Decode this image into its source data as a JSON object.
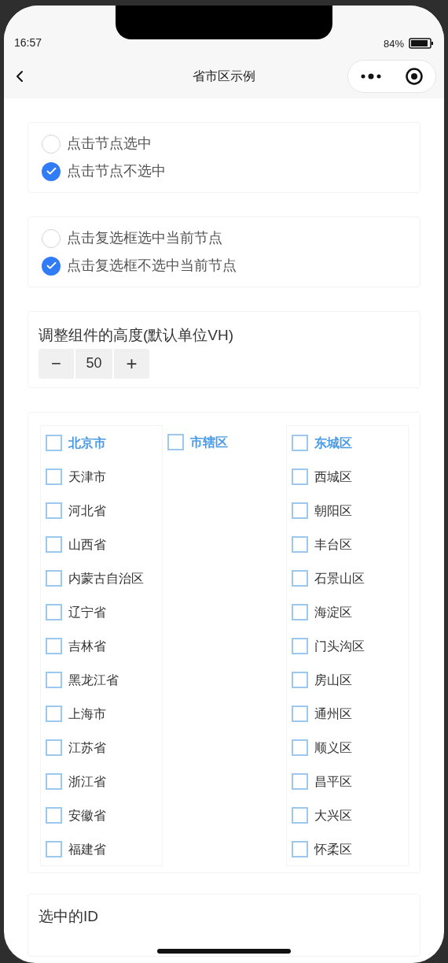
{
  "status_bar": {
    "time": "16:57",
    "battery": "84%"
  },
  "nav": {
    "title": "省市区示例"
  },
  "radio_groups": [
    {
      "options": [
        {
          "label": "点击节点选中",
          "selected": false
        },
        {
          "label": "点击节点不选中",
          "selected": true
        }
      ]
    },
    {
      "options": [
        {
          "label": "点击复选框选中当前节点",
          "selected": false
        },
        {
          "label": "点击复选框不选中当前节点",
          "selected": true
        }
      ]
    }
  ],
  "height_setting": {
    "label": "调整组件的高度(默认单位VH)",
    "minus": "−",
    "value": "50",
    "plus": "+"
  },
  "picker": {
    "columns": [
      {
        "items": [
          {
            "label": "北京市",
            "active": true,
            "checked": false
          },
          {
            "label": "天津市",
            "active": false,
            "checked": false
          },
          {
            "label": "河北省",
            "active": false,
            "checked": false
          },
          {
            "label": "山西省",
            "active": false,
            "checked": false
          },
          {
            "label": "内蒙古自治区",
            "active": false,
            "checked": false
          },
          {
            "label": "辽宁省",
            "active": false,
            "checked": false
          },
          {
            "label": "吉林省",
            "active": false,
            "checked": false
          },
          {
            "label": "黑龙江省",
            "active": false,
            "checked": false
          },
          {
            "label": "上海市",
            "active": false,
            "checked": false
          },
          {
            "label": "江苏省",
            "active": false,
            "checked": false
          },
          {
            "label": "浙江省",
            "active": false,
            "checked": false
          },
          {
            "label": "安徽省",
            "active": false,
            "checked": false
          },
          {
            "label": "福建省",
            "active": false,
            "checked": false
          }
        ]
      },
      {
        "items": [
          {
            "label": "市辖区",
            "active": true,
            "checked": false
          }
        ]
      },
      {
        "items": [
          {
            "label": "东城区",
            "active": true,
            "checked": false
          },
          {
            "label": "西城区",
            "active": false,
            "checked": false
          },
          {
            "label": "朝阳区",
            "active": false,
            "checked": false
          },
          {
            "label": "丰台区",
            "active": false,
            "checked": false
          },
          {
            "label": "石景山区",
            "active": false,
            "checked": false
          },
          {
            "label": "海淀区",
            "active": false,
            "checked": false
          },
          {
            "label": "门头沟区",
            "active": false,
            "checked": false
          },
          {
            "label": "房山区",
            "active": false,
            "checked": false
          },
          {
            "label": "通州区",
            "active": false,
            "checked": false
          },
          {
            "label": "顺义区",
            "active": false,
            "checked": false
          },
          {
            "label": "昌平区",
            "active": false,
            "checked": false
          },
          {
            "label": "大兴区",
            "active": false,
            "checked": false
          },
          {
            "label": "怀柔区",
            "active": false,
            "checked": false
          }
        ]
      }
    ]
  },
  "selected_ids": {
    "label": "选中的ID"
  }
}
